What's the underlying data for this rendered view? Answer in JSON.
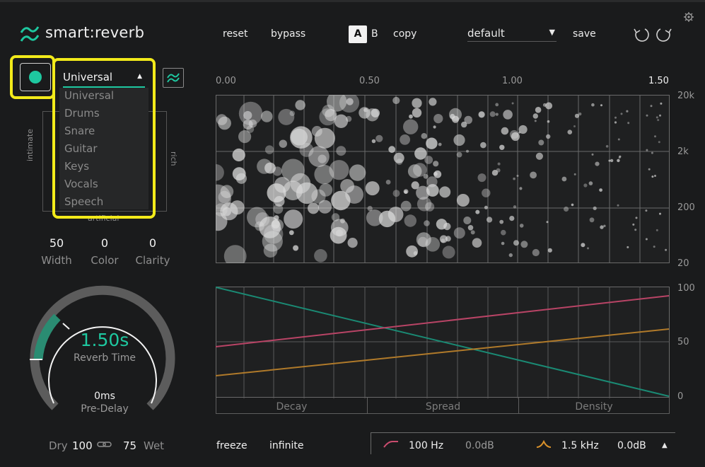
{
  "header": {
    "app_name": "smart:reverb",
    "reset": "reset",
    "bypass": "bypass",
    "a_label": "A",
    "b_label": "B",
    "copy": "copy",
    "preset": "default",
    "save": "save"
  },
  "profile": {
    "selected": "Universal",
    "options": [
      "Universal",
      "Drums",
      "Snare",
      "Guitar",
      "Keys",
      "Vocals",
      "Speech"
    ]
  },
  "xy_pad": {
    "left_label": "intimate",
    "right_label": "rich",
    "bottom_label": "artificial"
  },
  "params": [
    {
      "value": "50",
      "label": "Width"
    },
    {
      "value": "0",
      "label": "Color"
    },
    {
      "value": "0",
      "label": "Clarity"
    }
  ],
  "reverb_time": {
    "value": "1.50s",
    "label": "Reverb Time",
    "predelay_value": "0ms",
    "predelay_label": "Pre-Delay"
  },
  "mix": {
    "dry_label": "Dry",
    "dry_value": "100",
    "wet_value": "75",
    "wet_label": "Wet"
  },
  "time_axis": [
    "0.00",
    "0.50",
    "1.00",
    "1.50"
  ],
  "freq_axis": [
    "20k",
    "2k",
    "200",
    "20"
  ],
  "env_axis": [
    "100",
    "50",
    "0"
  ],
  "env_tabs": [
    "Decay",
    "Spread",
    "Density"
  ],
  "bottom": {
    "freeze": "freeze",
    "infinite": "infinite",
    "low_freq": "100 Hz",
    "low_gain": "0.0dB",
    "mid_freq": "1.5 kHz",
    "mid_gain": "0.0dB"
  },
  "colors": {
    "accent": "#1ec8a0",
    "highlight": "#f2ea1a",
    "decay_line": "#1a8a74",
    "spread_line": "#b94466",
    "density_line": "#b07a2a"
  },
  "icons": [
    "logo-icon",
    "settings-gear-icon",
    "undo-icon",
    "redo-icon",
    "power-icon",
    "profile-adapt-icon",
    "link-icon",
    "low-cut-icon",
    "mid-bell-icon",
    "expand-arrow-icon"
  ]
}
